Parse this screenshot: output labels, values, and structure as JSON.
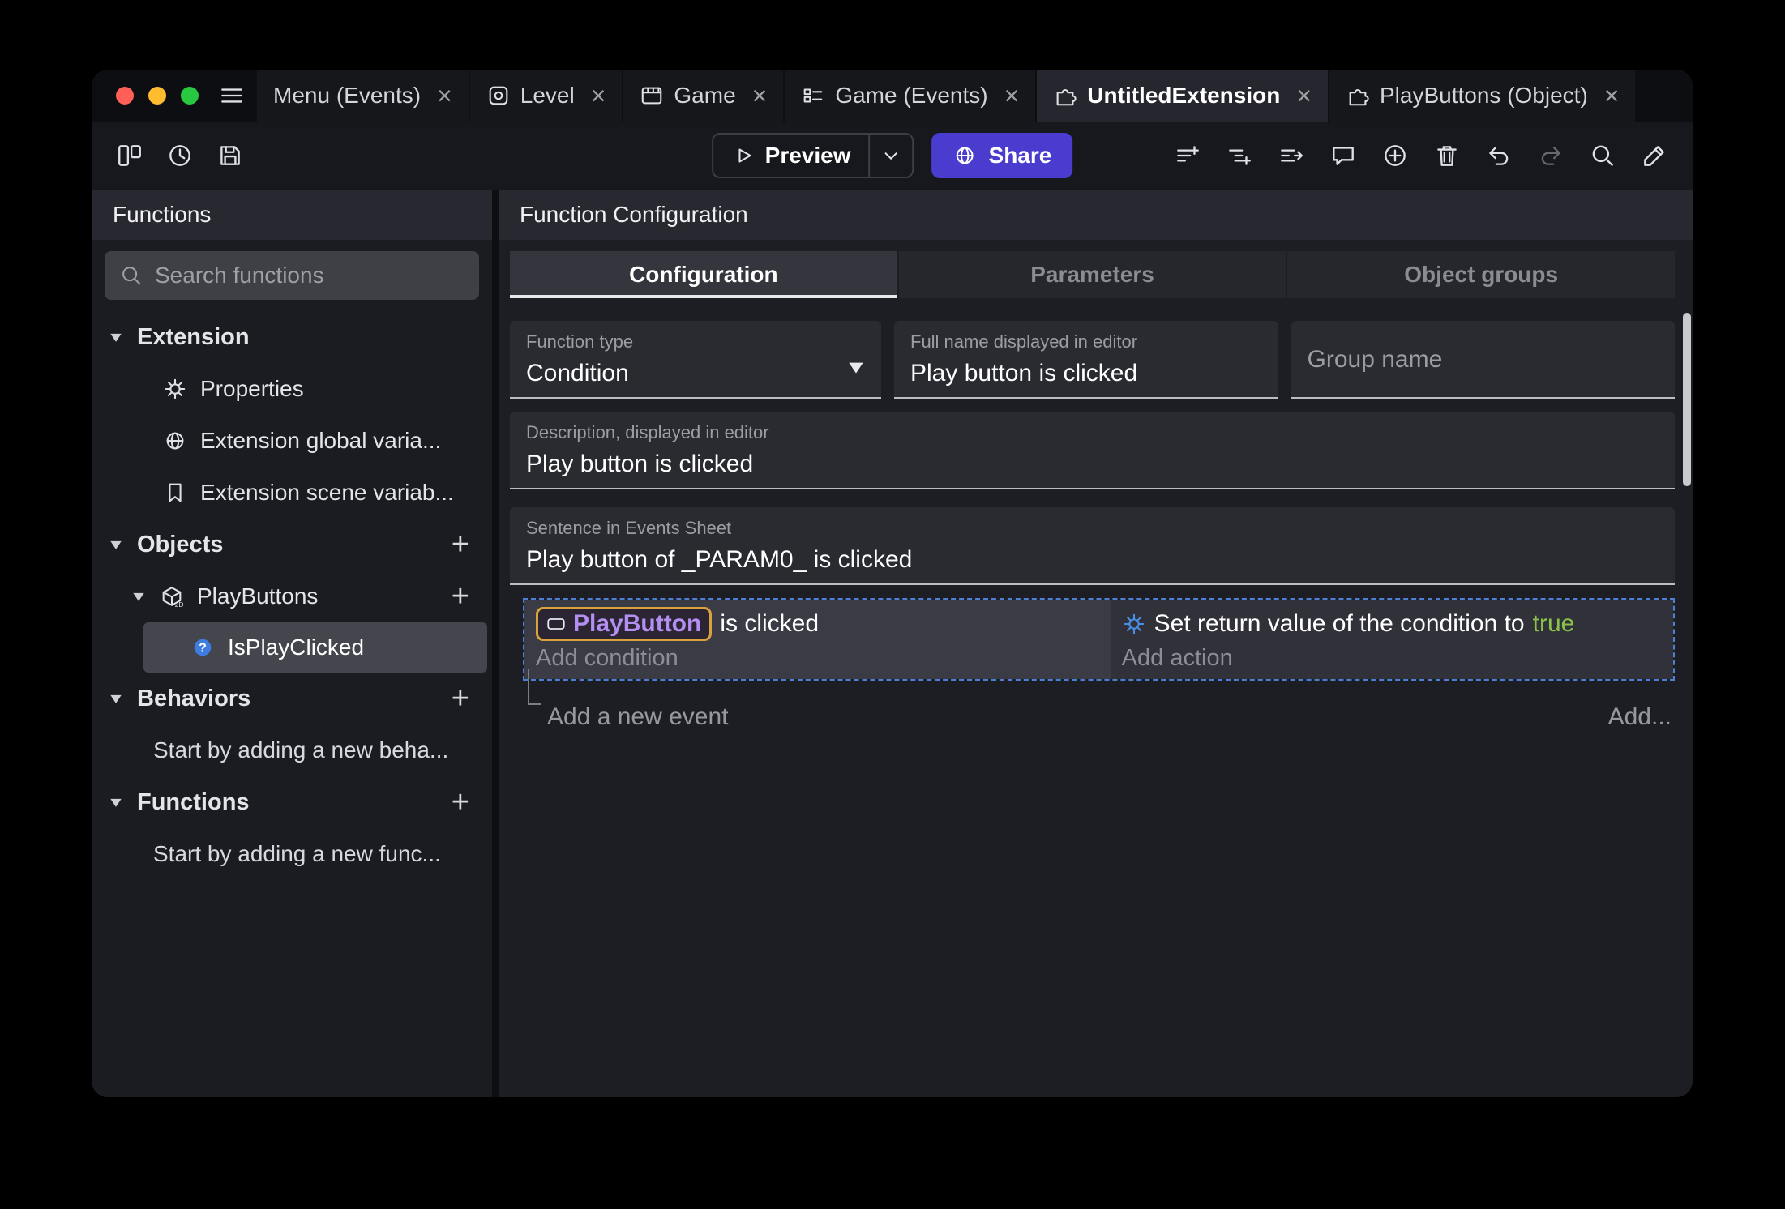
{
  "window": {
    "close_glyph": "×",
    "add_glyph": "+"
  },
  "tabs": {
    "items": [
      {
        "label": "Menu (Events)",
        "icon": "none",
        "active": false
      },
      {
        "label": "Level",
        "icon": "scene",
        "active": false
      },
      {
        "label": "Game",
        "icon": "film",
        "active": false
      },
      {
        "label": "Game (Events)",
        "icon": "events-list",
        "active": false
      },
      {
        "label": "UntitledExtension",
        "icon": "puzzle",
        "active": true
      },
      {
        "label": "PlayButtons (Object)",
        "icon": "puzzle",
        "active": false
      }
    ]
  },
  "toolbar": {
    "preview": "Preview",
    "share": "Share"
  },
  "sidebar": {
    "title": "Functions",
    "search_placeholder": "Search functions",
    "extension_header": "Extension",
    "extension_items": [
      "Properties",
      "Extension global varia...",
      "Extension scene variab..."
    ],
    "objects_header": "Objects",
    "playbuttons_label": "PlayButtons",
    "isplayclicked_label": "IsPlayClicked",
    "behaviors_header": "Behaviors",
    "behaviors_hint": "Start by adding a new beha...",
    "functions_header": "Functions",
    "functions_hint": "Start by adding a new func..."
  },
  "main": {
    "title": "Function Configuration",
    "tabs": [
      "Configuration",
      "Parameters",
      "Object groups"
    ],
    "fields": {
      "function_type_label": "Function type",
      "function_type_value": "Condition",
      "full_name_label": "Full name displayed in editor",
      "full_name_value": "Play button is clicked",
      "group_name_placeholder": "Group name",
      "description_label": "Description, displayed in editor",
      "description_value": "Play button is clicked",
      "sentence_label": "Sentence in Events Sheet",
      "sentence_value": "Play button of _PARAM0_ is clicked"
    },
    "events": {
      "condition_object": "PlayButton",
      "condition_text": "is clicked",
      "add_condition": "Add condition",
      "action_text": "Set return value of the condition to",
      "action_value": "true",
      "add_action": "Add action",
      "add_event": "Add a new event",
      "add_more": "Add..."
    }
  },
  "colors": {
    "accent_purple": "#4a3ccf",
    "object_purple": "#b48ef0",
    "chip_border": "#d9a23c",
    "true_green": "#8bc34a",
    "selection_blue": "#4d7fd6",
    "traffic_red": "#ff5f57",
    "traffic_yellow": "#febc2e",
    "traffic_green": "#28c840"
  }
}
